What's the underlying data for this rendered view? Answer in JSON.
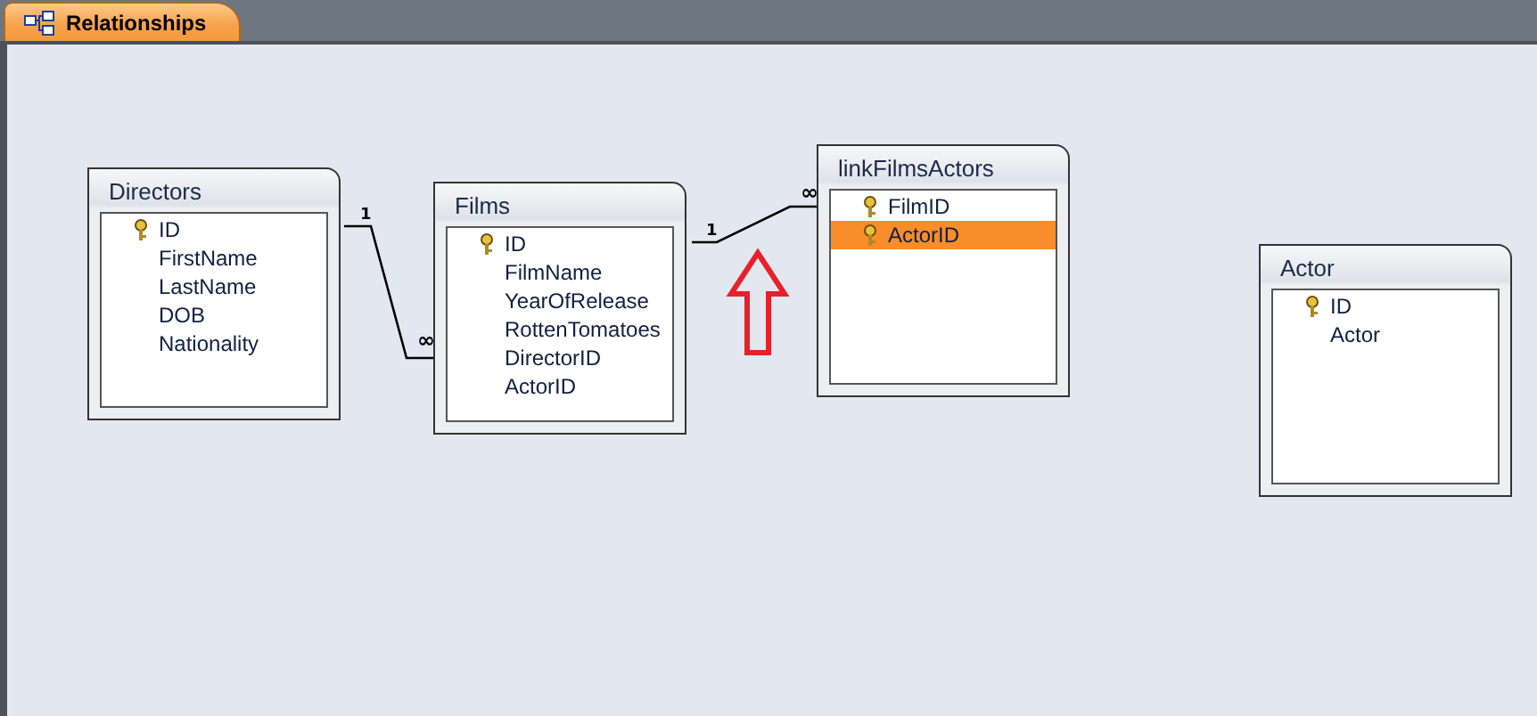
{
  "tab": {
    "title": "Relationships",
    "selected": true
  },
  "tables": [
    {
      "name": "Directors",
      "fields": [
        {
          "name": "ID",
          "key": true,
          "selected": false
        },
        {
          "name": "FirstName",
          "key": false,
          "selected": false
        },
        {
          "name": "LastName",
          "key": false,
          "selected": false
        },
        {
          "name": "DOB",
          "key": false,
          "selected": false
        },
        {
          "name": "Nationality",
          "key": false,
          "selected": false
        }
      ]
    },
    {
      "name": "Films",
      "fields": [
        {
          "name": "ID",
          "key": true,
          "selected": false
        },
        {
          "name": "FilmName",
          "key": false,
          "selected": false
        },
        {
          "name": "YearOfRelease",
          "key": false,
          "selected": false
        },
        {
          "name": "RottenTomatoes",
          "key": false,
          "selected": false
        },
        {
          "name": "DirectorID",
          "key": false,
          "selected": false
        },
        {
          "name": "ActorID",
          "key": false,
          "selected": false
        }
      ]
    },
    {
      "name": "linkFilmsActors",
      "fields": [
        {
          "name": "FilmID",
          "key": true,
          "selected": false
        },
        {
          "name": "ActorID",
          "key": true,
          "selected": true
        }
      ]
    },
    {
      "name": "Actor",
      "fields": [
        {
          "name": "ID",
          "key": true,
          "selected": false
        },
        {
          "name": "Actor",
          "key": false,
          "selected": false
        }
      ]
    }
  ],
  "relationships": [
    {
      "one_label": "1",
      "many_label": "∞"
    },
    {
      "one_label": "1",
      "many_label": "∞"
    }
  ]
}
